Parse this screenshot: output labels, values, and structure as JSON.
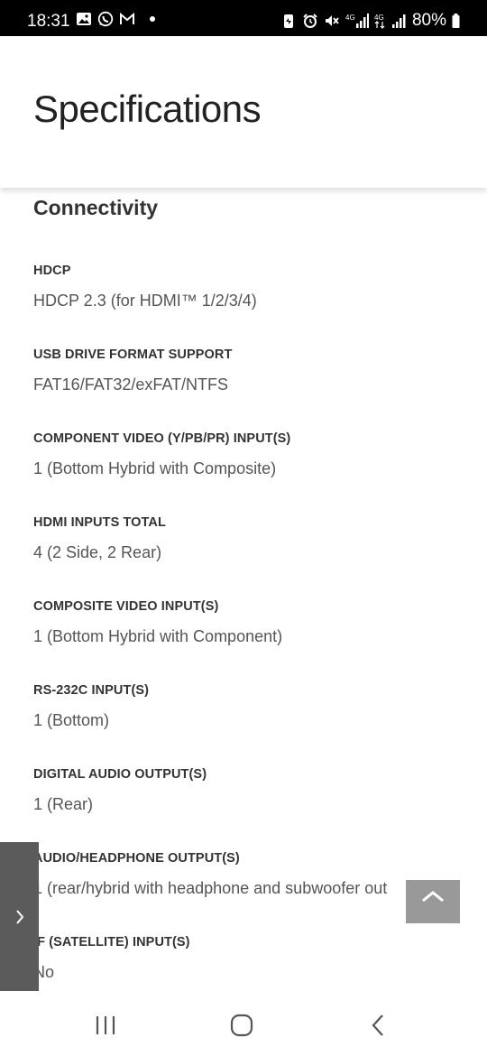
{
  "status_bar": {
    "time": "18:31",
    "left_icons": [
      "gallery-icon",
      "whatsapp-icon",
      "gmail-icon"
    ],
    "right_icons": [
      "battery-saver-icon",
      "alarm-icon",
      "mute-icon",
      "signal-4g-icon",
      "signal-4g-lte-icon",
      "wifi-signal-icon"
    ],
    "sig1": "4G",
    "sig2": "4G",
    "battery": "80%"
  },
  "header": {
    "title": "Specifications"
  },
  "section": {
    "title": "Connectivity"
  },
  "specs": [
    {
      "label": "HDCP",
      "value": "HDCP 2.3 (for HDMI™ 1/2/3/4)"
    },
    {
      "label": "USB DRIVE FORMAT SUPPORT",
      "value": "FAT16/FAT32/exFAT/NTFS"
    },
    {
      "label": "COMPONENT VIDEO (Y/PB/PR) INPUT(S)",
      "value": "1 (Bottom Hybrid with Composite)"
    },
    {
      "label": "HDMI INPUTS TOTAL",
      "value": "4 (2 Side, 2 Rear)"
    },
    {
      "label": "COMPOSITE VIDEO INPUT(S)",
      "value": "1 (Bottom Hybrid with Component)"
    },
    {
      "label": "RS-232C INPUT(S)",
      "value": "1 (Bottom)"
    },
    {
      "label": "DIGITAL AUDIO OUTPUT(S)",
      "value": "1 (Rear)"
    },
    {
      "label": "AUDIO/HEADPHONE OUTPUT(S)",
      "value": "1 (rear/hybrid with headphone and subwoofer out"
    },
    {
      "label": "IF (SATELLITE) INPUT(S)",
      "value": "No"
    }
  ],
  "side_tab": {
    "icon": "chevron-right-icon"
  },
  "scroll_top": {
    "icon": "chevron-up-icon"
  },
  "nav_bar": {
    "recents_icon": "recents-icon",
    "home_icon": "home-icon",
    "back_icon": "back-icon"
  },
  "colors": {
    "status_bg": "#000000",
    "side_tab_bg": "#5b5b5b",
    "scroll_top_bg": "#999999",
    "text_primary": "#333333",
    "text_value": "#555555"
  }
}
